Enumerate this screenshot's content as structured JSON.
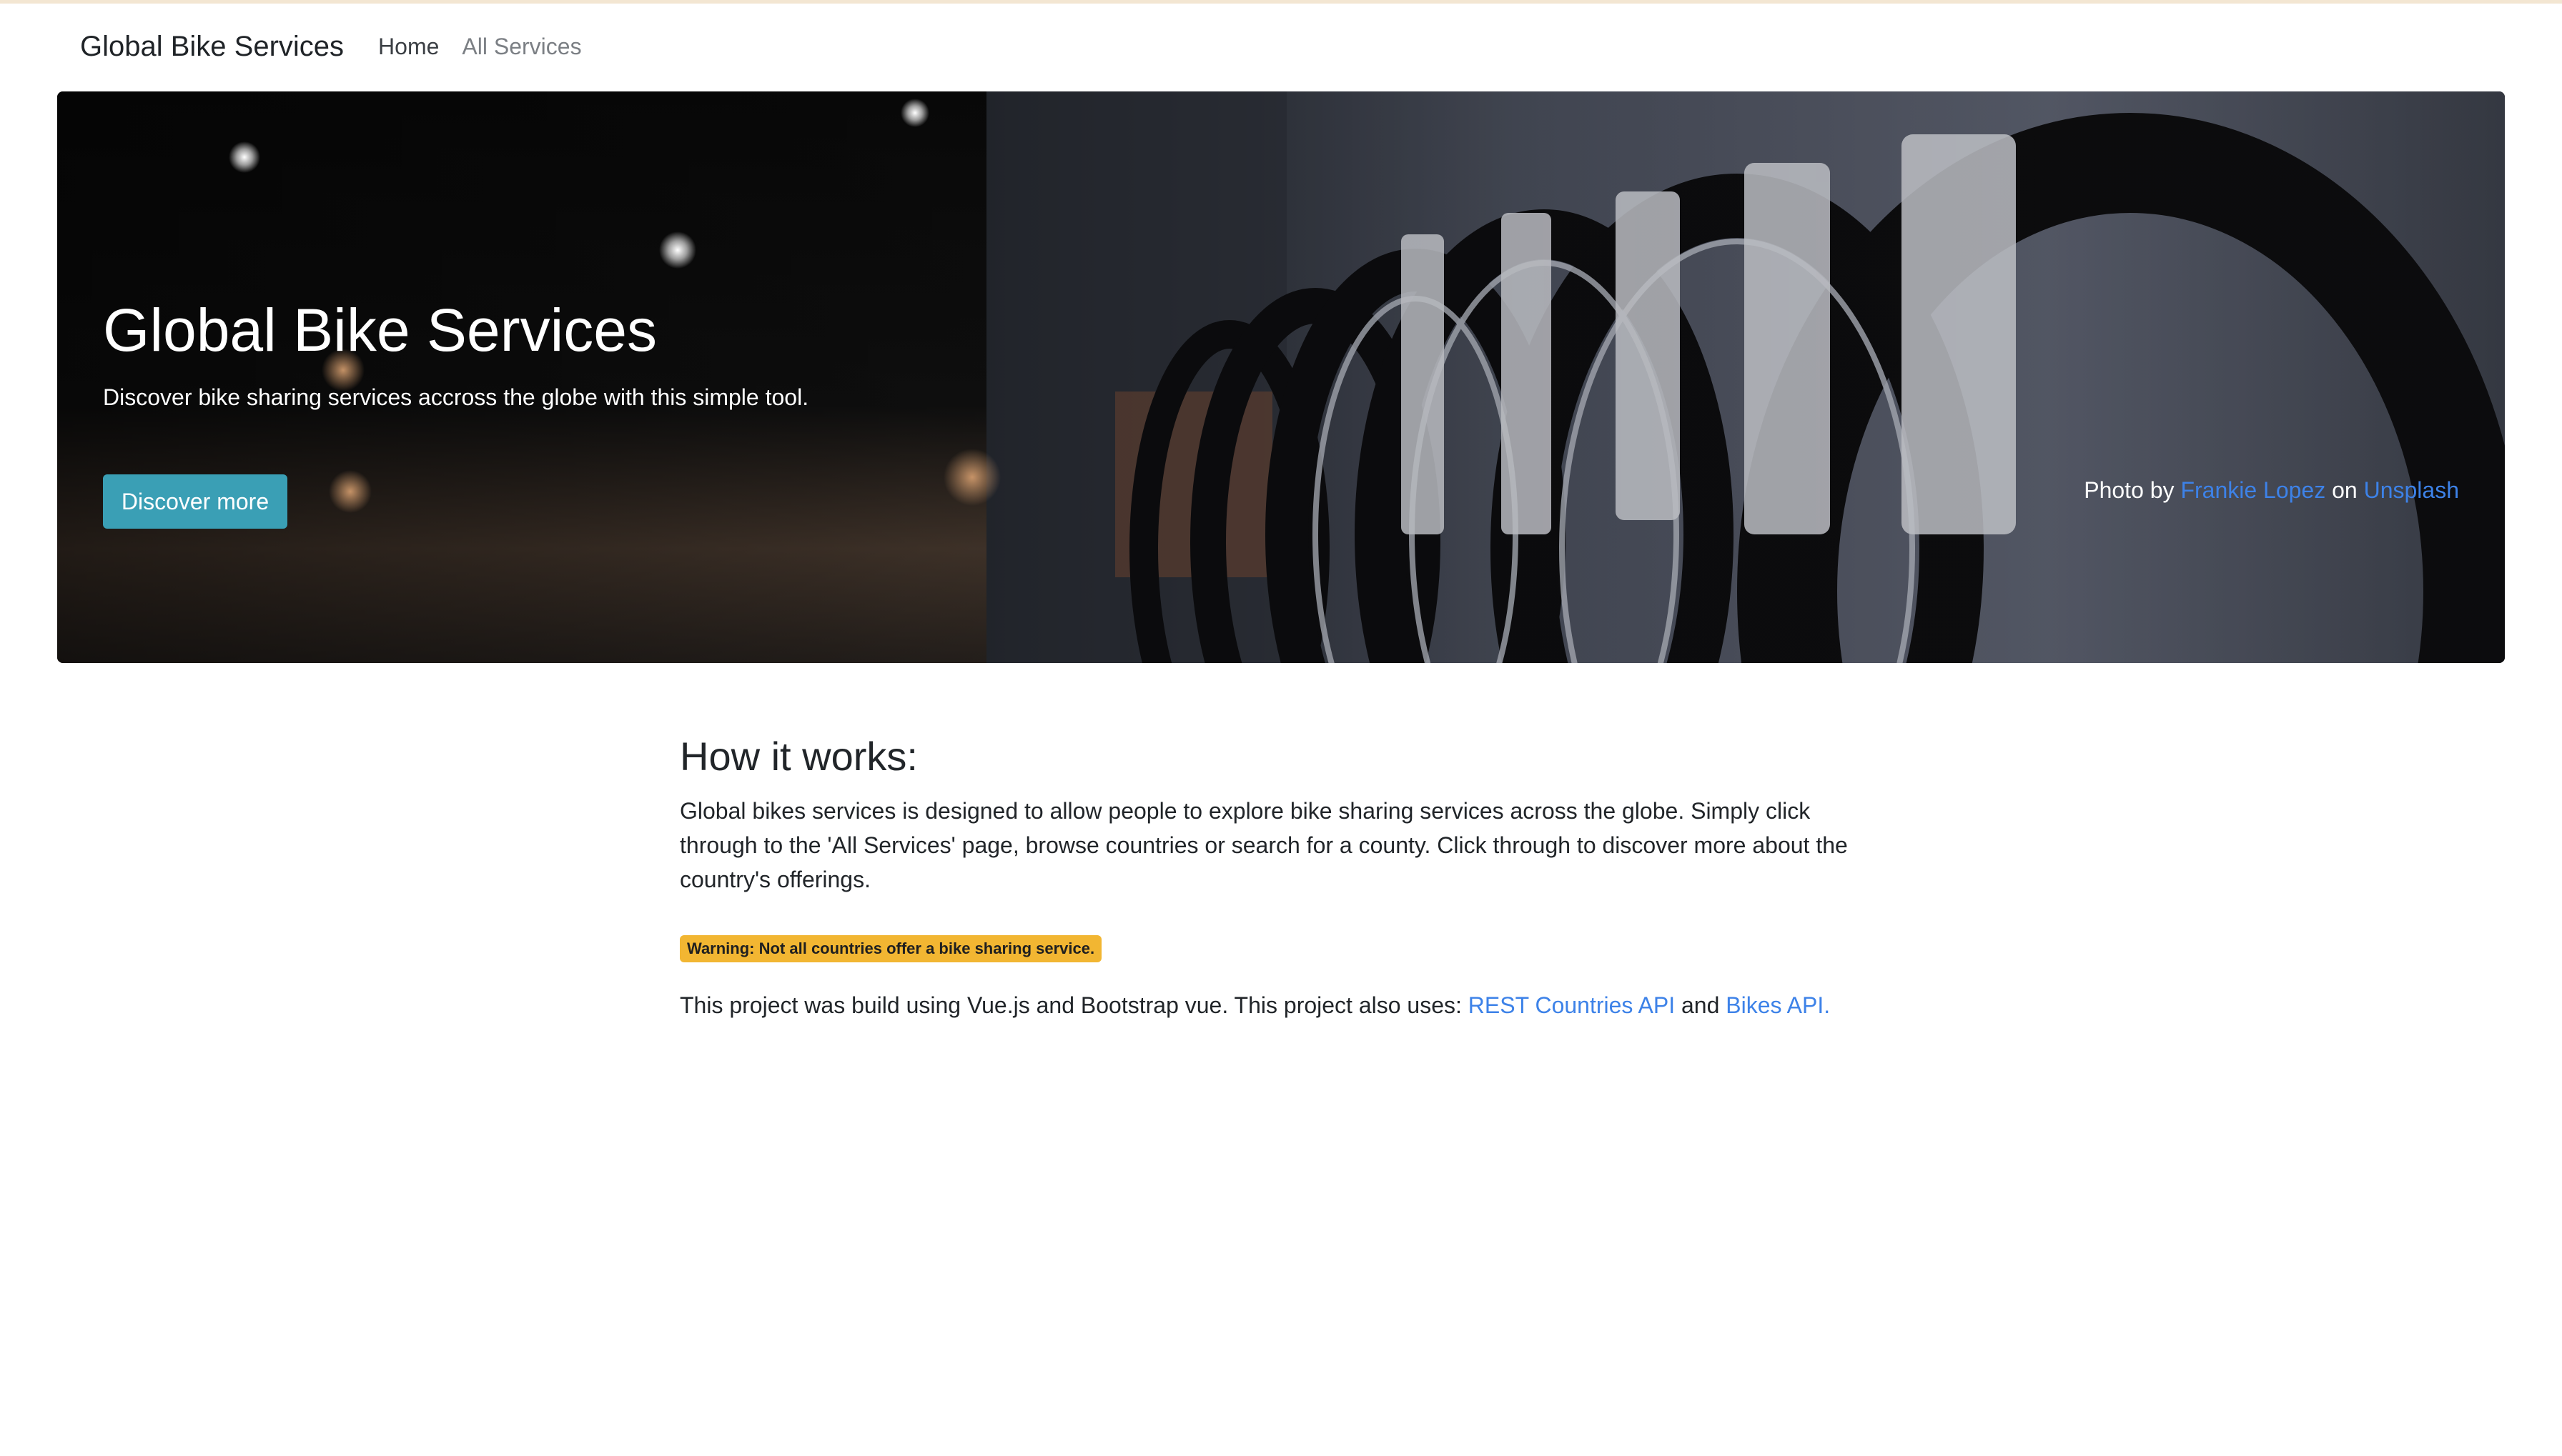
{
  "navbar": {
    "brand": "Global Bike Services",
    "links": [
      {
        "label": "Home"
      },
      {
        "label": "All Services"
      }
    ]
  },
  "hero": {
    "title": "Global Bike Services",
    "subtitle": "Discover bike sharing services accross the globe with this simple tool.",
    "button_label": "Discover more",
    "credit": {
      "prefix": "Photo by",
      "photographer": "Frankie Lopez",
      "middle": "on",
      "site": "Unsplash"
    }
  },
  "main": {
    "heading": "How it works:",
    "description": "Global bikes services is designed to allow people to explore bike sharing services across the globe. Simply click through to the 'All Services' page, browse countries or search for a county. Click through to discover more about the country's offerings.",
    "warning_badge": "Warning: Not all countries offer a bike sharing service.",
    "footer": {
      "text": "This project was build using Vue.js and Bootstrap vue. This project also uses:",
      "link1": "REST Countries API",
      "conjunction": "and",
      "link2": "Bikes API."
    }
  },
  "colors": {
    "button": "#3a9fb5",
    "link": "#3d82e8",
    "warning": "#f2b632"
  }
}
